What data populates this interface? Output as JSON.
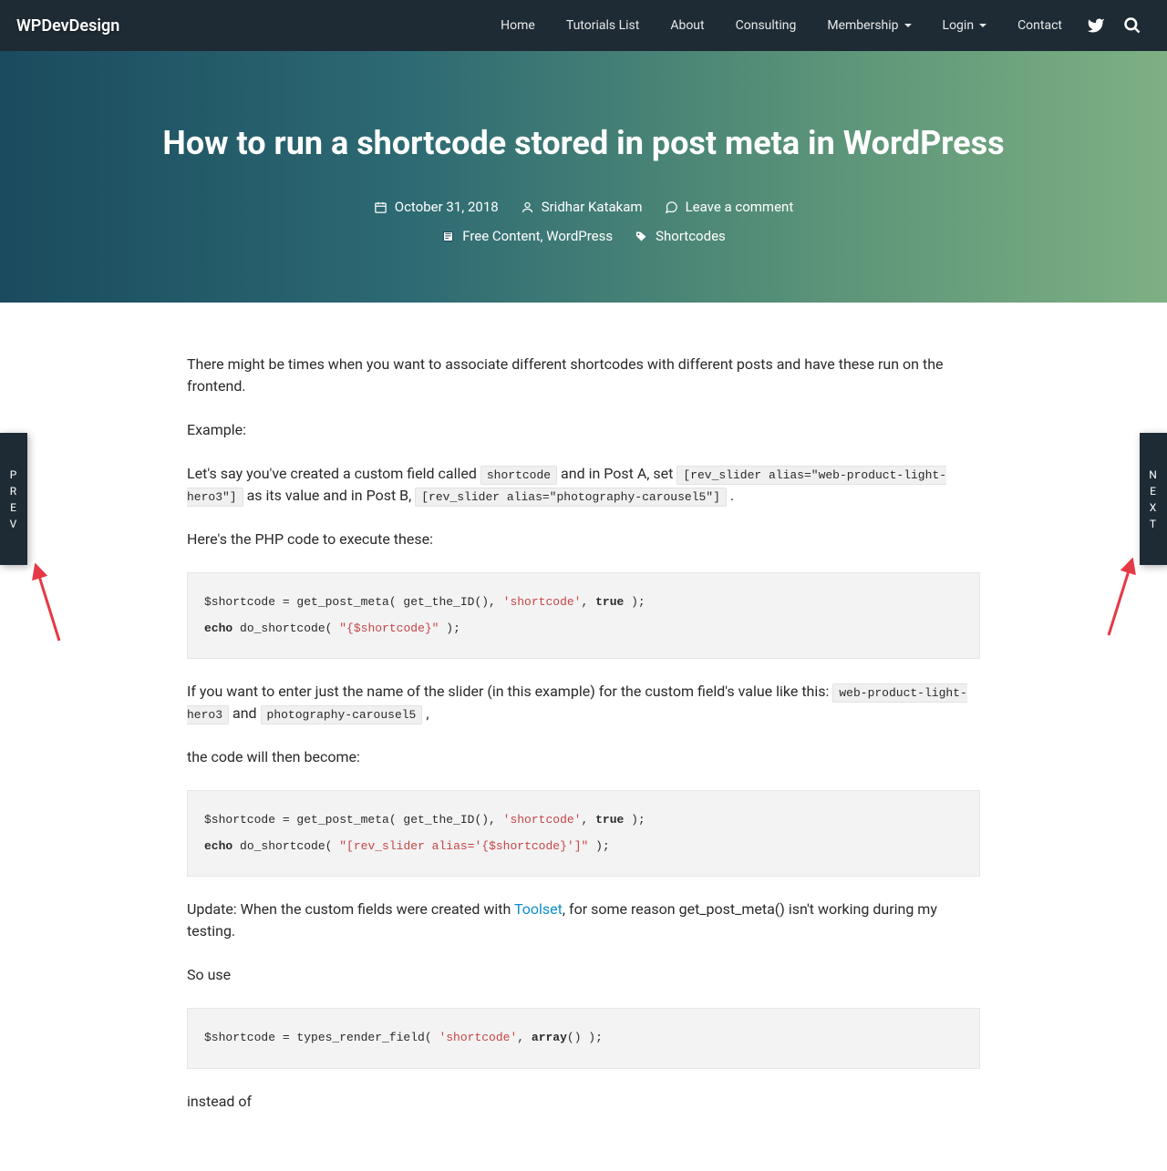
{
  "navbar": {
    "brand": "WPDevDesign",
    "links": [
      {
        "label": "Home",
        "has_dropdown": false
      },
      {
        "label": "Tutorials List",
        "has_dropdown": false
      },
      {
        "label": "About",
        "has_dropdown": false
      },
      {
        "label": "Consulting",
        "has_dropdown": false
      },
      {
        "label": "Membership",
        "has_dropdown": true
      },
      {
        "label": "Login",
        "has_dropdown": true
      },
      {
        "label": "Contact",
        "has_dropdown": false
      }
    ]
  },
  "hero": {
    "title": "How to run a shortcode stored in post meta in WordPress",
    "date": "October 31, 2018",
    "author": "Sridhar Katakam",
    "comment_link": "Leave a comment",
    "categories": "Free Content, WordPress",
    "tags": "Shortcodes"
  },
  "content": {
    "p1": "There might be times when you want to associate different shortcodes with different posts and have these run on the frontend.",
    "p2": "Example:",
    "p3a": "Let's say you've created a custom field called ",
    "p3_code1": "shortcode",
    "p3b": " and in Post A, set ",
    "p3_code2": "[rev_slider alias=\"web-product-light-hero3\"]",
    "p3c": " as its value and in Post B, ",
    "p3_code3": "[rev_slider alias=\"photography-carousel5\"]",
    "p3d": " .",
    "p4": "Here's the PHP code to execute these:",
    "code1_l1a": "$shortcode = get_post_meta( get_the_ID(), ",
    "code1_l1b": "'shortcode'",
    "code1_l1c": ", ",
    "code1_l1d": "true",
    "code1_l1e": " );",
    "code1_l2a": "echo",
    "code1_l2b": " do_shortcode( ",
    "code1_l2c": "\"{$shortcode}\"",
    "code1_l2d": " );",
    "p5a": "If you want to enter just the name of the slider (in this example) for the custom field's value like this: ",
    "p5_code1": "web-product-light-hero3",
    "p5b": " and ",
    "p5_code2": "photography-carousel5",
    "p5c": " ,",
    "p6": "the code will then become:",
    "code2_l1a": "$shortcode = get_post_meta( get_the_ID(), ",
    "code2_l1b": "'shortcode'",
    "code2_l1c": ", ",
    "code2_l1d": "true",
    "code2_l1e": " );",
    "code2_l2a": "echo",
    "code2_l2b": " do_shortcode( ",
    "code2_l2c": "\"[rev_slider alias='{$shortcode}']\"",
    "code2_l2d": " );",
    "p7a": "Update: When the custom fields were created with ",
    "p7_link": "Toolset",
    "p7b": ", for some reason get_post_meta() isn't working during my testing.",
    "p8": "So use",
    "code3_l1a": "$shortcode = types_render_field( ",
    "code3_l1b": "'shortcode'",
    "code3_l1c": ", ",
    "code3_l1d": "array",
    "code3_l1e": "() );",
    "p9": "instead of"
  },
  "side": {
    "prev": "P\nR\nE\nV",
    "next": "N\nE\nX\nT"
  }
}
